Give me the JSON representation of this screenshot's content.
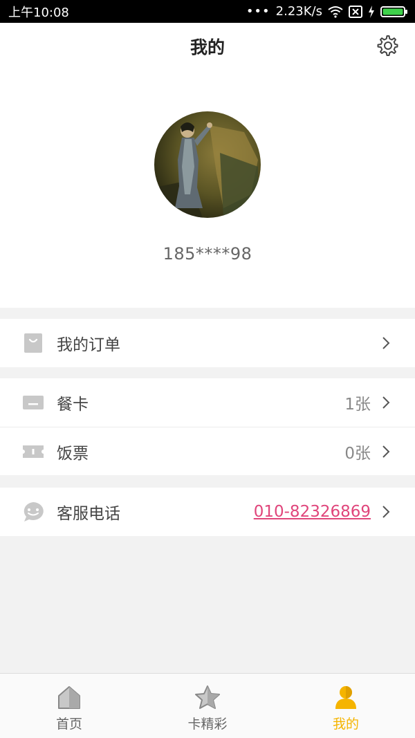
{
  "status_bar": {
    "time": "上午10:08",
    "dots": "•••",
    "network_speed": "2.23K/s"
  },
  "header": {
    "title": "我的"
  },
  "profile": {
    "phone": "185****98"
  },
  "menu": {
    "orders": {
      "label": "我的订单",
      "icon": "bag-icon"
    },
    "meal_card": {
      "label": "餐卡",
      "value": "1张",
      "icon": "card-icon"
    },
    "meal_ticket": {
      "label": "饭票",
      "value": "0张",
      "icon": "ticket-icon"
    },
    "customer_service": {
      "label": "客服电话",
      "value": "010-82326869",
      "icon": "smile-chat-icon"
    }
  },
  "tabs": [
    {
      "label": "首页",
      "icon": "home-icon",
      "active": false
    },
    {
      "label": "卡精彩",
      "icon": "star-icon",
      "active": false
    },
    {
      "label": "我的",
      "icon": "user-icon",
      "active": true
    }
  ],
  "colors": {
    "accent": "#f5b400",
    "link": "#e0457b",
    "icon_gray": "#c8c8c8"
  }
}
